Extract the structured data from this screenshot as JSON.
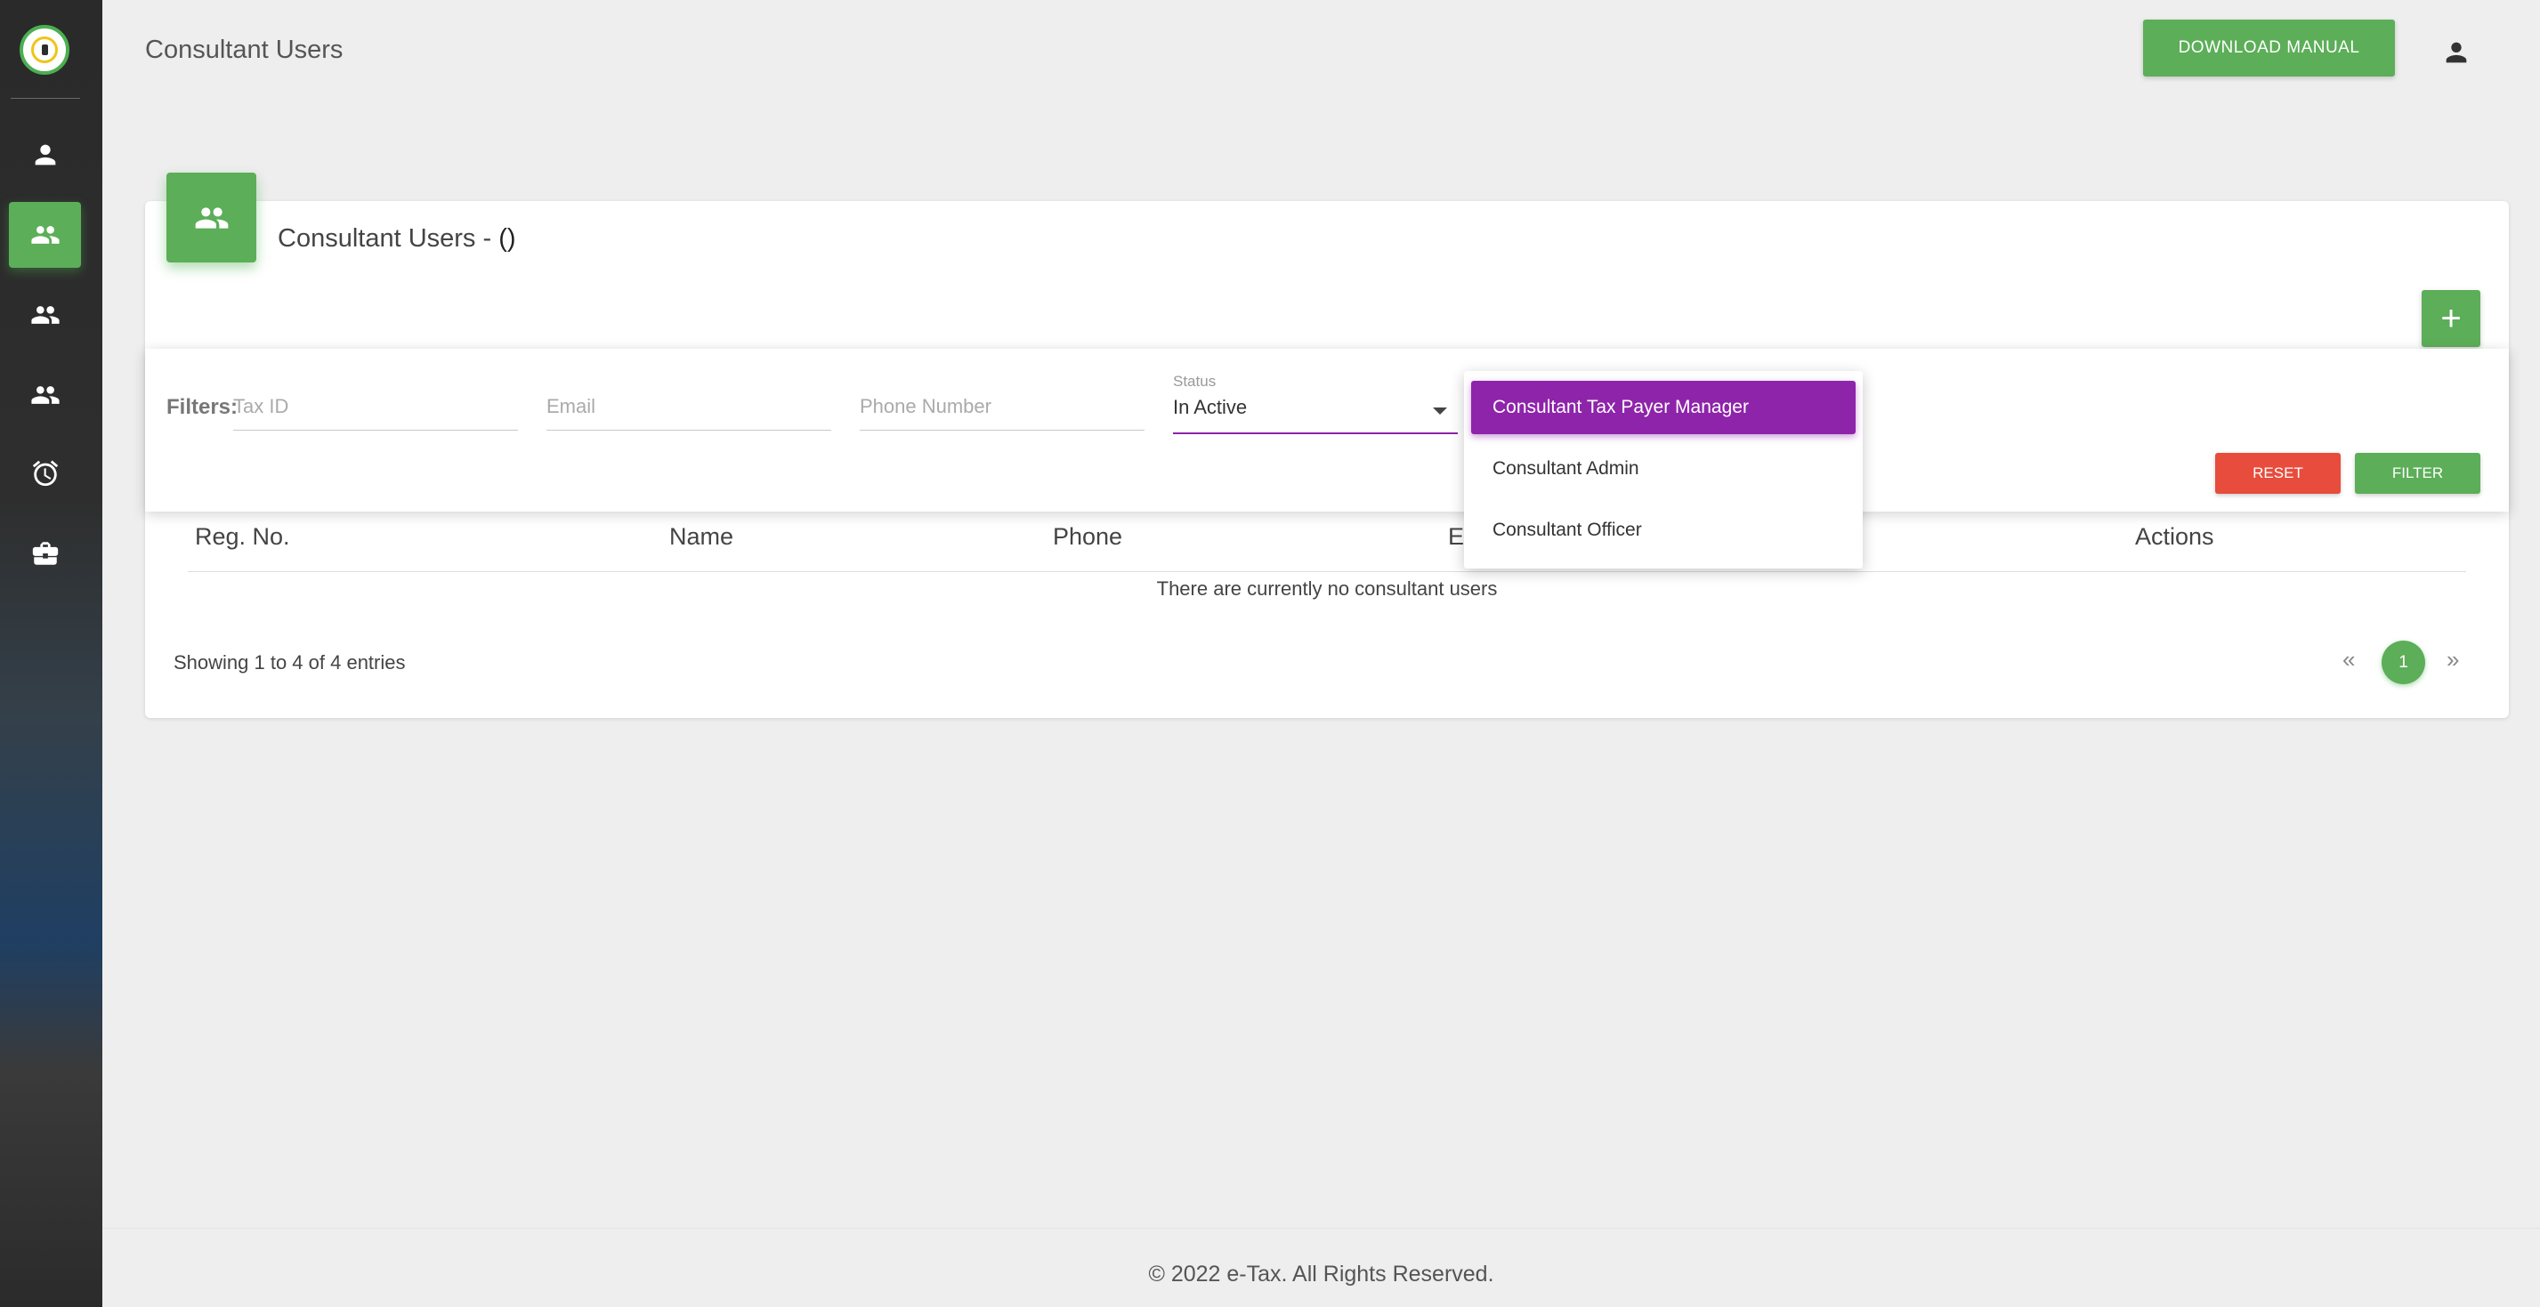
{
  "header": {
    "page_title": "Consultant Users",
    "download_label": "DOWNLOAD MANUAL"
  },
  "sidebar": {
    "items": [
      {
        "icon": "person-icon",
        "active": false
      },
      {
        "icon": "people-icon",
        "active": true
      },
      {
        "icon": "people-icon",
        "active": false
      },
      {
        "icon": "people-icon",
        "active": false
      },
      {
        "icon": "alarm-icon",
        "active": false
      },
      {
        "icon": "briefcase-icon",
        "active": false
      }
    ]
  },
  "card": {
    "title": "Consultant Users - ",
    "count": "()"
  },
  "filters": {
    "label": "Filters:",
    "tax_id_placeholder": "Tax ID",
    "email_placeholder": "Email",
    "phone_placeholder": "Phone Number",
    "status_label": "Status",
    "status_value": "In Active",
    "reset_label": "RESET",
    "filter_label": "FILTER"
  },
  "dropdown": {
    "options": [
      {
        "label": "Consultant Tax Payer Manager",
        "selected": true
      },
      {
        "label": "Consultant Admin",
        "selected": false
      },
      {
        "label": "Consultant Officer",
        "selected": false
      }
    ]
  },
  "table": {
    "columns": [
      "Reg. No.",
      "Name",
      "Phone",
      "E",
      "Actions"
    ],
    "empty_message": "There are currently no consultant users"
  },
  "pagination": {
    "summary": "Showing 1 to 4 of 4 entries",
    "prev": "«",
    "current": "1",
    "next": "»"
  },
  "footer": {
    "text": "© 2022 e-Tax. All Rights Reserved."
  },
  "colors": {
    "accent_green": "#5cae58",
    "accent_purple": "#8e24aa",
    "reset_red": "#e74c3c"
  }
}
